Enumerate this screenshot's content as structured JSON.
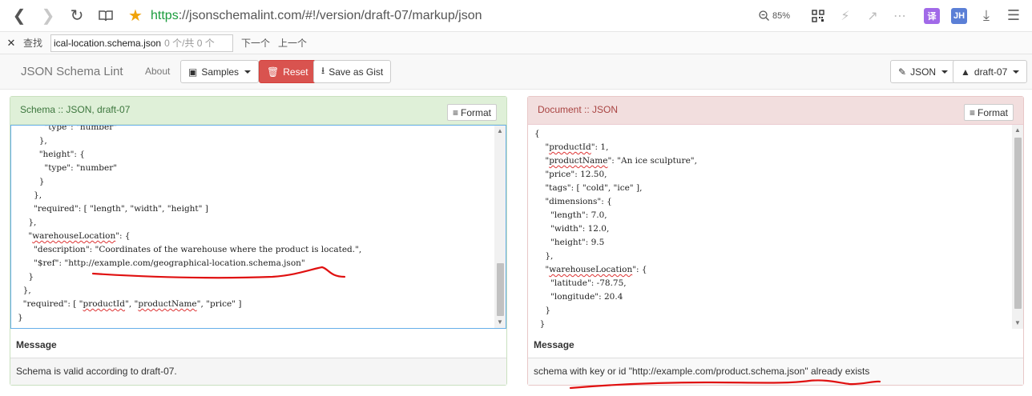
{
  "browser": {
    "url_scheme": "https",
    "url_rest": "://jsonschemalint.com/#!/version/draft-07/markup/json",
    "zoom": "85%",
    "ext_translate": "译",
    "ext_jh": "JH",
    "colors": {
      "translate_badge": "#a16ae8",
      "jh_badge": "#5b7fd6",
      "star": "#f0a30a"
    }
  },
  "find_bar": {
    "label": "查找",
    "query": "ical-location.schema.json",
    "count": "0 个/共 0 个",
    "next": "下一个",
    "prev": "上一个"
  },
  "navbar": {
    "brand": "JSON Schema Lint",
    "about": "About",
    "samples": "Samples",
    "reset": "Reset",
    "save_gist": "Save as Gist",
    "format_select": "JSON",
    "draft_select": "draft-07"
  },
  "schema_panel": {
    "title": "Schema :: JSON, draft-07",
    "format_btn": "Format",
    "message_header": "Message",
    "message": "Schema is valid according to draft-07.",
    "code_lines": [
      "          \"type\": \"number\"",
      "        },",
      "        \"height\": {",
      "          \"type\": \"number\"",
      "        }",
      "      },",
      "      \"required\": [ \"length\", \"width\", \"height\" ]",
      "    },",
      "    \"warehouseLocation\": {",
      "      \"description\": \"Coordinates of the warehouse where the product is located.\",",
      "      \"$ref\": \"http://example.com/geographical-location.schema.json\"",
      "    }",
      "  },",
      "  \"required\": [ \"productId\", \"productName\", \"price\" ]",
      "}"
    ]
  },
  "document_panel": {
    "title": "Document :: JSON",
    "format_btn": "Format",
    "message_header": "Message",
    "message": "schema with key or id \"http://example.com/product.schema.json\" already exists",
    "code_lines": [
      "{",
      "    \"productId\": 1,",
      "    \"productName\": \"An ice sculpture\",",
      "    \"price\": 12.50,",
      "    \"tags\": [ \"cold\", \"ice\" ],",
      "    \"dimensions\": {",
      "      \"length\": 7.0,",
      "      \"width\": 12.0,",
      "      \"height\": 9.5",
      "    },",
      "    \"warehouseLocation\": {",
      "      \"latitude\": -78.75,",
      "      \"longitude\": 20.4",
      "    }",
      "  }"
    ]
  },
  "annotation_color": "#e01010"
}
